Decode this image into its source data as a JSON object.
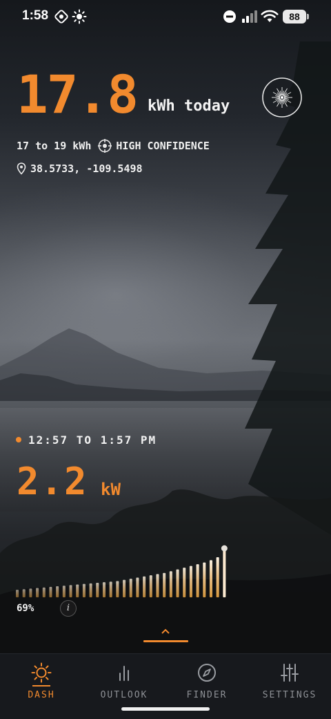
{
  "status_bar": {
    "time": "1:58",
    "battery": "88",
    "icons": [
      "focus-icon",
      "brightness-icon",
      "do-not-disturb-icon",
      "cellular-signal-icon",
      "wifi-icon",
      "battery-icon"
    ]
  },
  "today": {
    "value": "17.8",
    "unit": "kWh today",
    "range": "17 to 19 kWh",
    "confidence": "HIGH CONFIDENCE",
    "coordinates": "38.5733, -109.5498"
  },
  "current": {
    "window": "12:57 TO 1:57 PM",
    "power_value": "2.2",
    "power_unit": "kW",
    "percent": "69%",
    "info_label": "i"
  },
  "production_bars": {
    "count": 32,
    "levels": [
      0.13,
      0.14,
      0.15,
      0.16,
      0.17,
      0.18,
      0.19,
      0.2,
      0.21,
      0.22,
      0.23,
      0.24,
      0.25,
      0.26,
      0.27,
      0.28,
      0.3,
      0.32,
      0.34,
      0.36,
      0.38,
      0.4,
      0.42,
      0.45,
      0.48,
      0.51,
      0.54,
      0.57,
      0.6,
      0.64,
      0.69,
      0.82
    ]
  },
  "nav": {
    "tabs": [
      {
        "label": "DASH",
        "icon": "sun-icon",
        "active": true
      },
      {
        "label": "OUTLOOK",
        "icon": "bar-chart-icon",
        "active": false
      },
      {
        "label": "FINDER",
        "icon": "compass-icon",
        "active": false
      },
      {
        "label": "SETTINGS",
        "icon": "sliders-icon",
        "active": false
      }
    ]
  },
  "colors": {
    "accent": "#f28a2e",
    "text": "#f2f2f2",
    "tab_inactive": "#8e9196",
    "tab_bar": "#17191d"
  }
}
